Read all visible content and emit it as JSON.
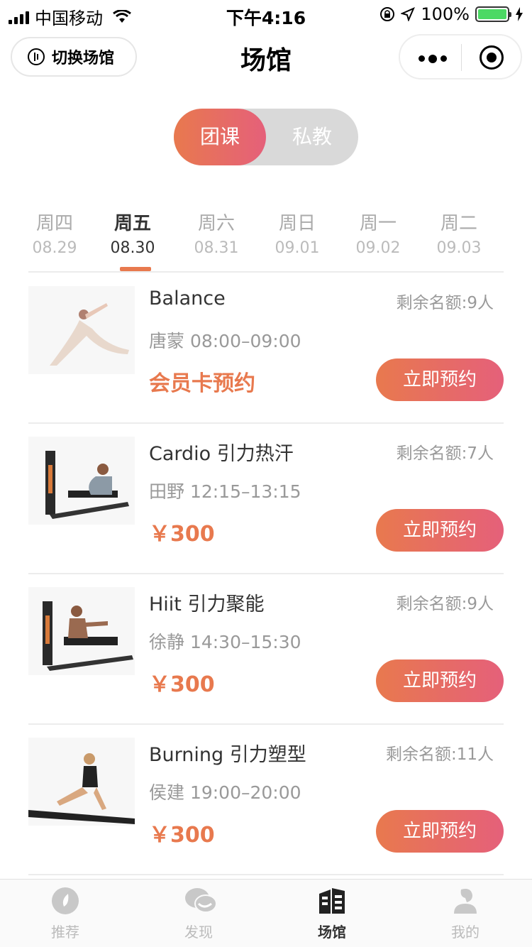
{
  "status_bar": {
    "carrier": "中国移动",
    "time": "下午4:16",
    "battery": "100%"
  },
  "nav": {
    "switch_venue": "切换场馆",
    "title": "场馆"
  },
  "segment": {
    "active": "团课",
    "inactive": "私教"
  },
  "dates": [
    {
      "day": "周四",
      "date": "08.29"
    },
    {
      "day": "周五",
      "date": "08.30"
    },
    {
      "day": "周六",
      "date": "08.31"
    },
    {
      "day": "周日",
      "date": "09.01"
    },
    {
      "day": "周一",
      "date": "09.02"
    },
    {
      "day": "周二",
      "date": "09.03"
    }
  ],
  "classes": [
    {
      "name": "Balance",
      "quota": "剩余名额:9人",
      "coach_time": "唐蒙 08:00–09:00",
      "price": "会员卡预约",
      "button": "立即预约"
    },
    {
      "name": "Cardio 引力热汗",
      "quota": "剩余名额:7人",
      "coach_time": "田野 12:15–13:15",
      "price": "￥300",
      "button": "立即预约"
    },
    {
      "name": "Hiit 引力聚能",
      "quota": "剩余名额:9人",
      "coach_time": "徐静 14:30–15:30",
      "price": "￥300",
      "button": "立即预约"
    },
    {
      "name": "Burning 引力塑型",
      "quota": "剩余名额:11人",
      "coach_time": "侯建 19:00–20:00",
      "price": "￥300",
      "button": "立即预约"
    }
  ],
  "tabs": [
    {
      "label": "推荐",
      "icon": "compass-icon"
    },
    {
      "label": "发现",
      "icon": "chat-bubbles-icon"
    },
    {
      "label": "场馆",
      "icon": "building-icon"
    },
    {
      "label": "我的",
      "icon": "user-icon"
    }
  ],
  "colors": {
    "accent": "#e8794e",
    "accent_end": "#e5607a"
  }
}
